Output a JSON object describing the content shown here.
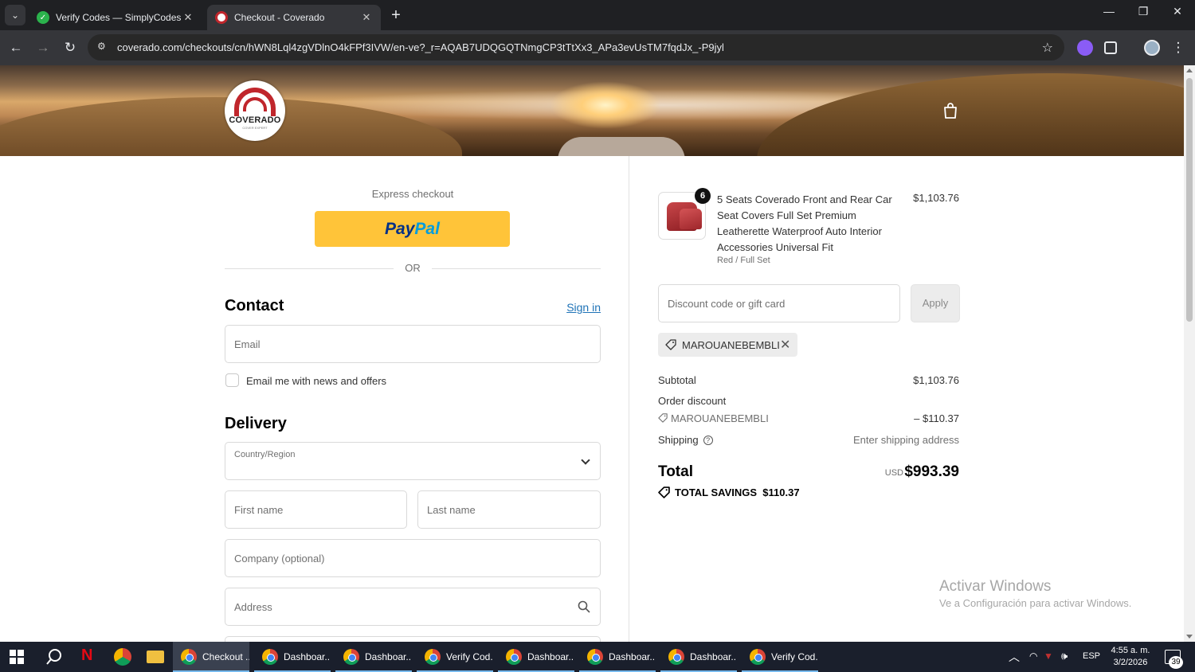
{
  "browser": {
    "tabs": [
      {
        "title": "Verify Codes — SimplyCodes",
        "active": false
      },
      {
        "title": "Checkout - Coverado",
        "active": true
      }
    ],
    "url": "coverado.com/checkouts/cn/hWN8Lql4zgVDlnO4kFPf3IVW/en-ve?_r=AQAB7UDQGQTNmgCP3tTtXx3_APa3evUsTM7fqdJx_-P9jyl"
  },
  "store": {
    "logo_name": "COVERADO",
    "logo_tagline": "COVER EXPERT"
  },
  "checkout": {
    "express_label": "Express checkout",
    "paypal_pay": "Pay",
    "paypal_pal": "Pal",
    "or_label": "OR",
    "contact_heading": "Contact",
    "signin_label": "Sign in",
    "email_placeholder": "Email",
    "newsletter_label": "Email me with news and offers",
    "delivery_heading": "Delivery",
    "country_label": "Country/Region",
    "first_name_placeholder": "First name",
    "last_name_placeholder": "Last name",
    "company_placeholder": "Company (optional)",
    "address_placeholder": "Address"
  },
  "summary": {
    "product": {
      "name": "5 Seats Coverado Front and Rear Car Seat Covers Full Set Premium Leatherette Waterproof Auto Interior Accessories Universal Fit",
      "variant": "Red / Full Set",
      "price": "$1,103.76",
      "quantity": "6"
    },
    "discount_placeholder": "Discount code or gift card",
    "apply_label": "Apply",
    "applied_code": "MAROUANEBEMBLI",
    "subtotal_label": "Subtotal",
    "subtotal_value": "$1,103.76",
    "order_discount_label": "Order discount",
    "discount_code": "MAROUANEBEMBLI",
    "discount_value": "– $110.37",
    "shipping_label": "Shipping",
    "shipping_value": "Enter shipping address",
    "total_label": "Total",
    "currency": "USD",
    "total_value": "$993.39",
    "savings_label": "TOTAL SAVINGS",
    "savings_value": "$110.37"
  },
  "watermark": {
    "title": "Activar Windows",
    "subtitle": "Ve a Configuración para activar Windows."
  },
  "taskbar": {
    "items": [
      "Checkout ...",
      "Dashboar...",
      "Dashboar...",
      "Verify Cod...",
      "Dashboar...",
      "Dashboar...",
      "Dashboar...",
      "Verify Cod..."
    ],
    "language": "ESP",
    "time": "4:55 a. m.",
    "date": "3/2/2026",
    "notification_count": "39"
  },
  "colors": {
    "paypal_yellow": "#ffc439",
    "link_blue": "#1f73b7",
    "brand_red": "#c0262c"
  }
}
